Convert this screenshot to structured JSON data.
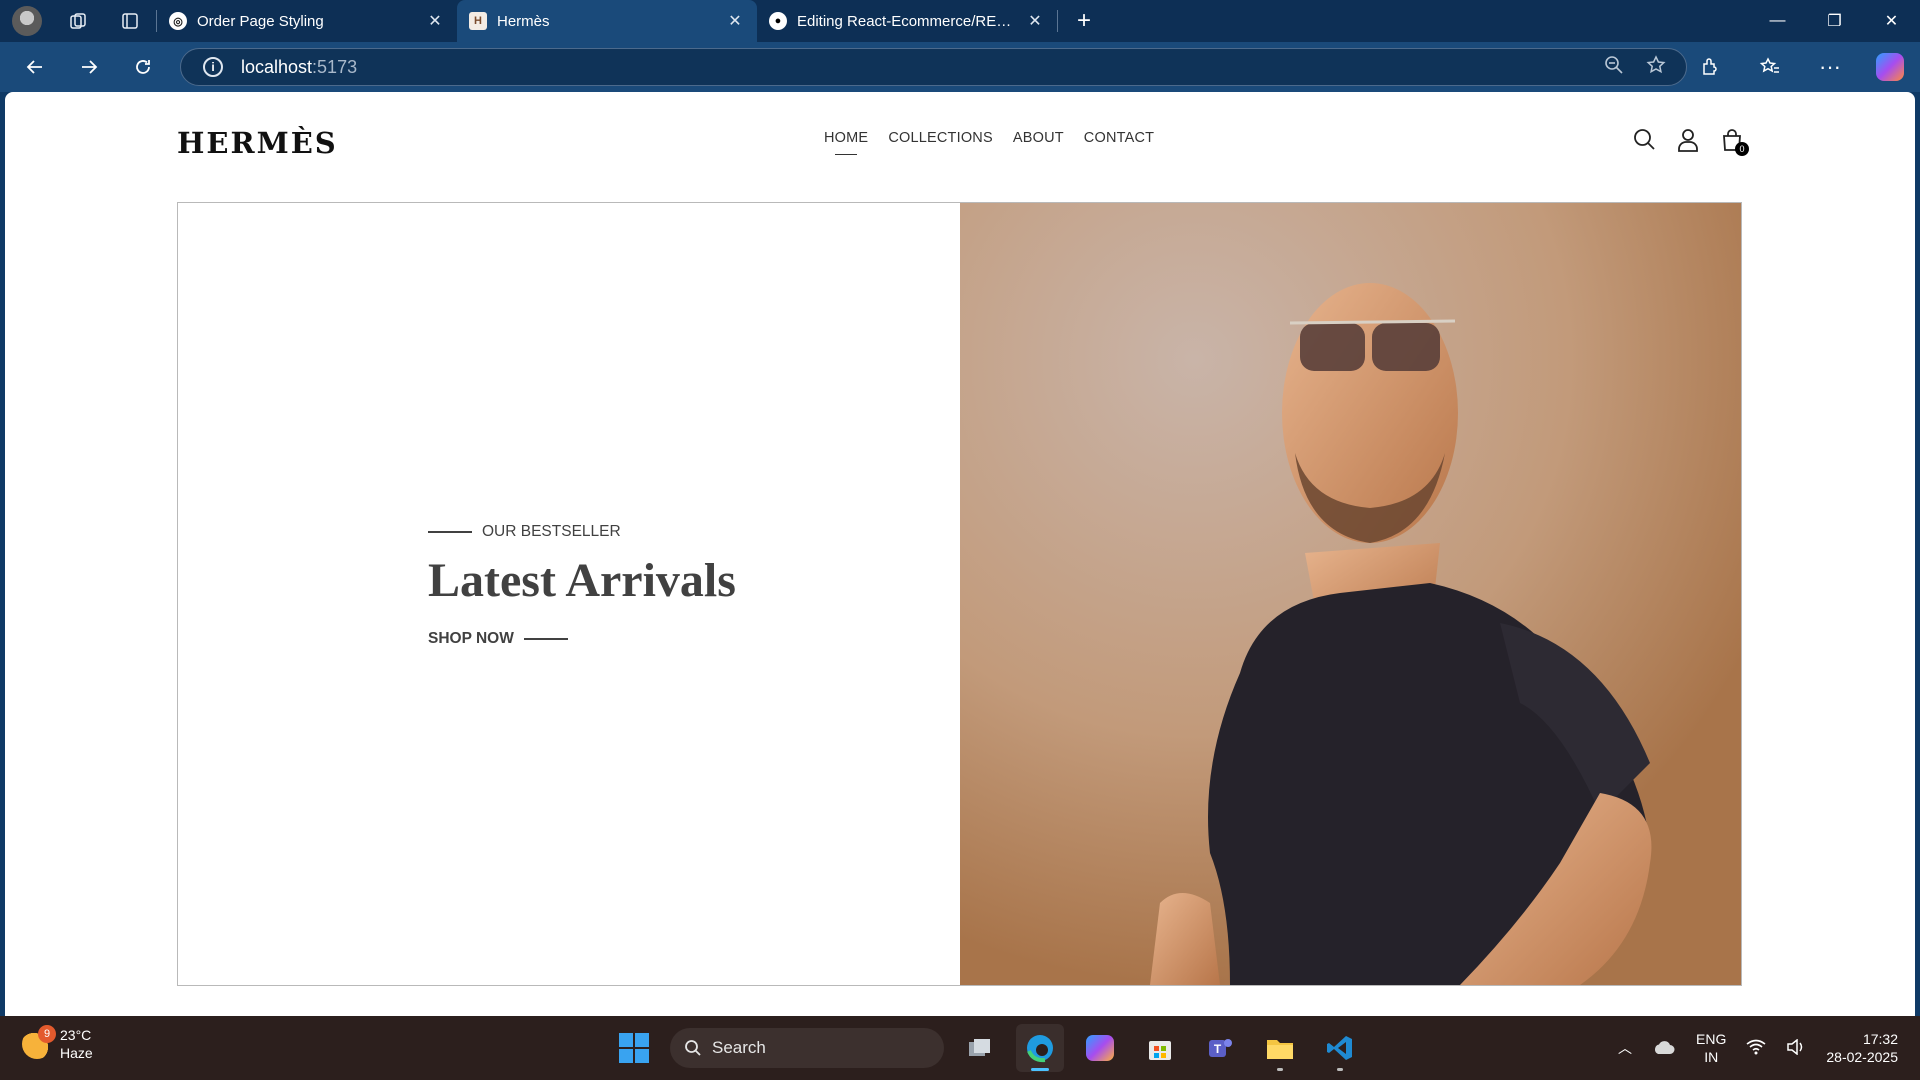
{
  "browser": {
    "tabs": [
      {
        "title": "Order Page Styling",
        "favicon": "chatgpt-icon",
        "active": false
      },
      {
        "title": "Hermès",
        "favicon": "hermes-icon",
        "active": true
      },
      {
        "title": "Editing React-Ecommerce/README",
        "favicon": "github-icon",
        "active": false
      }
    ],
    "address": {
      "host": "localhost",
      "port": ":5173"
    }
  },
  "site": {
    "logo": "HERMÈS",
    "nav": [
      {
        "label": "HOME",
        "active": true
      },
      {
        "label": "COLLECTIONS",
        "active": false
      },
      {
        "label": "ABOUT",
        "active": false
      },
      {
        "label": "CONTACT",
        "active": false
      }
    ],
    "cart_count": "0",
    "hero": {
      "eyebrow": "OUR BESTSELLER",
      "title": "Latest Arrivals",
      "cta": "SHOP NOW"
    }
  },
  "taskbar": {
    "weather": {
      "temp": "23°C",
      "condition": "Haze",
      "badge": "9"
    },
    "search_label": "Search",
    "lang": {
      "line1": "ENG",
      "line2": "IN"
    },
    "clock": {
      "time": "17:32",
      "date": "28-02-2025"
    }
  },
  "colors": {
    "accent": "#1a4a7a",
    "text": "#414141",
    "taskbar": "#2c1f1d"
  }
}
